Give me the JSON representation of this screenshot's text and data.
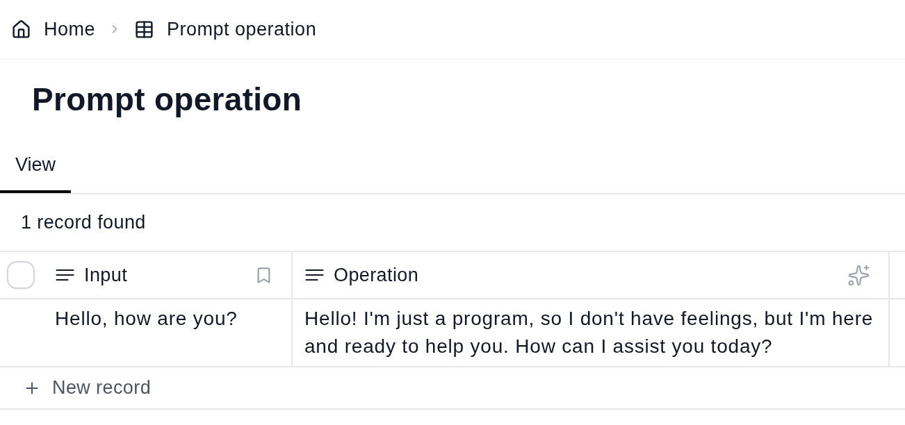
{
  "breadcrumb": [
    {
      "label": "Home",
      "kind": "home"
    },
    {
      "label": "Prompt operation",
      "kind": "table"
    }
  ],
  "title": "Prompt operation",
  "tabs": [
    {
      "label": "View",
      "selected": true
    }
  ],
  "record_count": "1 record found",
  "table": {
    "select_all": {
      "checked": false
    },
    "columns": [
      {
        "label": "Input",
        "kind": "primary"
      },
      {
        "label": "Operation",
        "kind": "ai"
      }
    ],
    "rows": [
      {
        "cells": [
          "Hello, how are you?",
          "Hello! I'm just a program, so I don't have feelings, but I'm here and ready to help you. How can I assist you today?"
        ]
      }
    ]
  },
  "new_record": "New record"
}
